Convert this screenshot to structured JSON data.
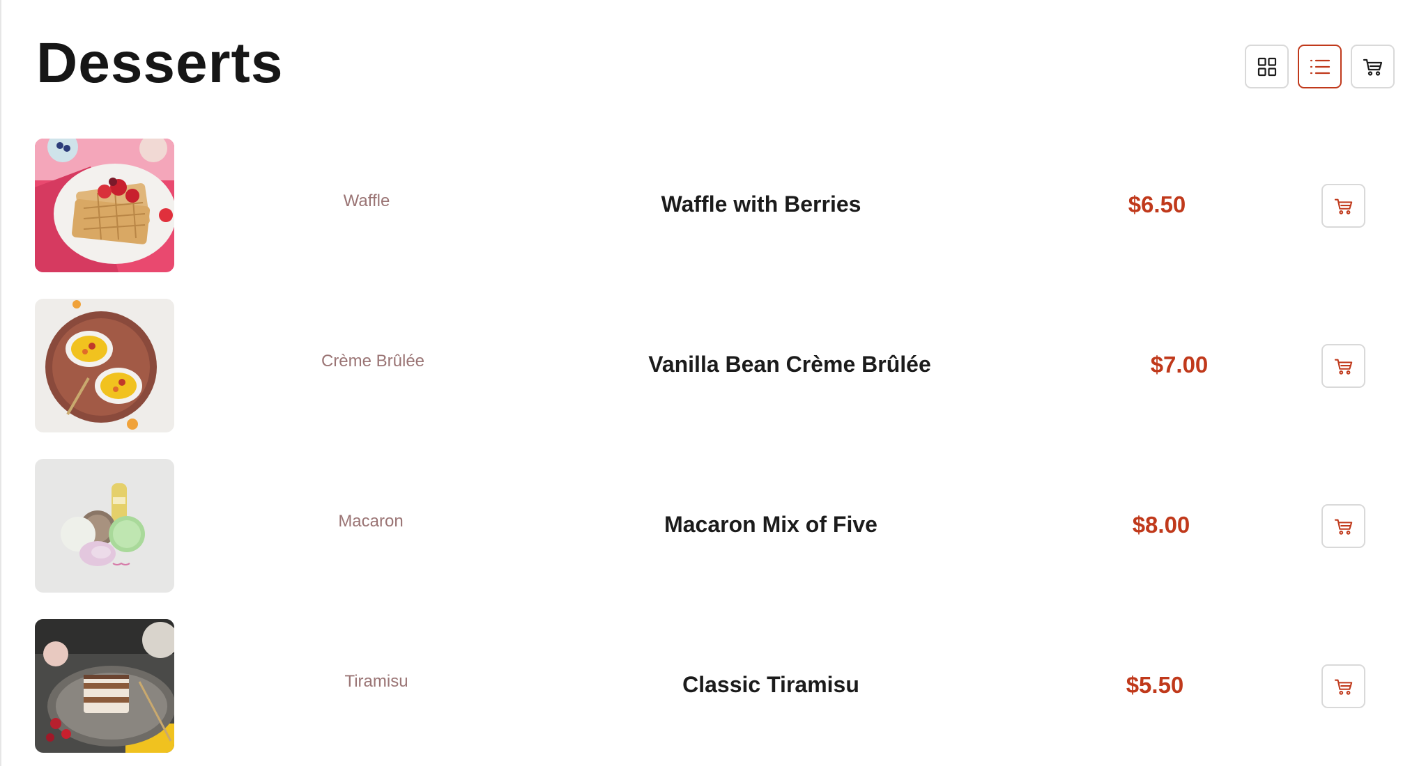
{
  "page": {
    "title": "Desserts"
  },
  "toolbar": {
    "buttons": [
      {
        "name": "grid-view",
        "icon": "grid-icon",
        "active": false
      },
      {
        "name": "list-view",
        "icon": "list-icon",
        "active": true
      },
      {
        "name": "cart",
        "icon": "cart-icon",
        "active": false
      }
    ]
  },
  "colors": {
    "accent": "#c0391b",
    "category_text": "#9a7474",
    "title_text": "#161616",
    "border": "#d9d9d9"
  },
  "products": [
    {
      "category": "Waffle",
      "name": "Waffle with Berries",
      "price": "$6.50",
      "image_icon": "waffle-photo",
      "cart_icon": "cart-icon"
    },
    {
      "category": "Crème Brûlée",
      "name": "Vanilla Bean Crème Brûlée",
      "price": "$7.00",
      "image_icon": "creme-brulee-photo",
      "cart_icon": "cart-icon"
    },
    {
      "category": "Macaron",
      "name": "Macaron Mix of Five",
      "price": "$8.00",
      "image_icon": "macaron-photo",
      "cart_icon": "cart-icon"
    },
    {
      "category": "Tiramisu",
      "name": "Classic Tiramisu",
      "price": "$5.50",
      "image_icon": "tiramisu-photo",
      "cart_icon": "cart-icon"
    }
  ]
}
